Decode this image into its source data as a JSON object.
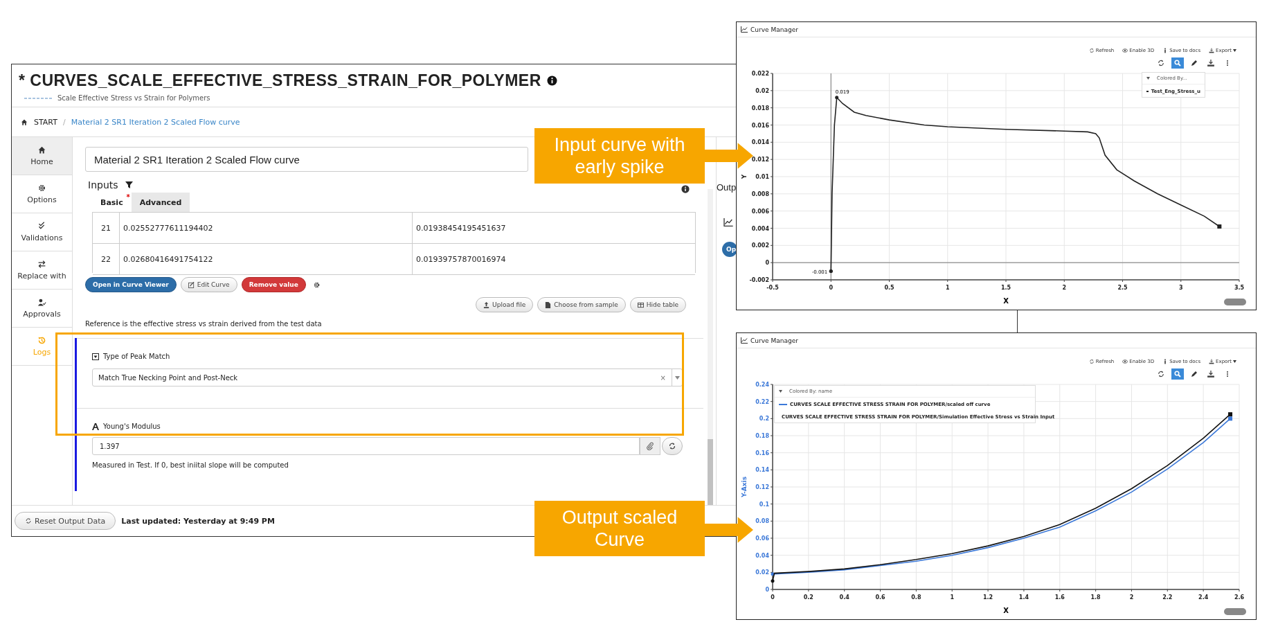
{
  "app_window": {
    "title_prefix": "*",
    "title": "CURVES_SCALE_EFFECTIVE_STRESS_STRAIN_FOR_POLYMER",
    "subtitle": "Scale Effective Stress vs Strain for Polymers",
    "breadcrumb_separator": "/",
    "breadcrumb": [
      {
        "label": "START"
      },
      {
        "label": "Material 2 SR1 Iteration 2 Scaled Flow curve"
      }
    ],
    "sidebar": {
      "items": [
        {
          "label": "Home",
          "selected": true,
          "highlighted": false
        },
        {
          "label": "Options",
          "selected": false,
          "highlighted": false
        },
        {
          "label": "Validations",
          "selected": false,
          "highlighted": false
        },
        {
          "label": "Replace with",
          "selected": false,
          "highlighted": false
        },
        {
          "label": "Approvals",
          "selected": false,
          "highlighted": false
        },
        {
          "label": "Logs",
          "selected": false,
          "highlighted": true
        }
      ]
    },
    "name_field": {
      "value": "Material 2 SR1 Iteration 2 Scaled Flow curve"
    },
    "inputs": {
      "heading": "Inputs",
      "tabs": [
        {
          "label": "Basic",
          "required_mark": "*",
          "selected": false
        },
        {
          "label": "Advanced",
          "selected": true
        }
      ],
      "table": {
        "rows": [
          [
            "21",
            "0.02552777611194402",
            "0.01938454195451637"
          ],
          [
            "22",
            "0.02680416491754122",
            "0.01939757870016974"
          ]
        ]
      },
      "buttons": [
        {
          "label": "Open in Curve Viewer",
          "kind": "primary"
        },
        {
          "label": "Edit Curve",
          "kind": "default"
        },
        {
          "label": "Remove value",
          "kind": "danger"
        }
      ],
      "file_buttons": [
        {
          "label": "Upload file"
        },
        {
          "label": "Choose from sample"
        },
        {
          "label": "Hide table"
        }
      ],
      "reference_text": "Reference is the effective stress vs strain derived from the test data",
      "fields": [
        {
          "kind": "select",
          "label": "Type of Peak Match",
          "value": "Match True Necking Point and Post-Neck",
          "clear_glyph": "×"
        },
        {
          "kind": "text",
          "label": "Young's Modulus",
          "value": "1.397",
          "hint": "Measured in Test. If 0, best iniital slope will be computed"
        }
      ]
    },
    "outputs": {
      "heading": "Outp",
      "button": "Op"
    },
    "footer": {
      "button": "Reset Output Data",
      "status": "Last updated: Yesterday at 9:49 PM"
    }
  },
  "callouts": [
    {
      "text": "Input curve with early spike"
    },
    {
      "text": "Output scaled Curve"
    }
  ],
  "chart_windows": [
    {
      "title": "Curve Manager",
      "toolbar": [
        "Refresh",
        "Enable 3D",
        "Save to docs",
        "Export"
      ],
      "legend_header": "Colored By...",
      "chart_data": {
        "type": "line",
        "grid": true,
        "xlabel": "X",
        "ylabel": "Y",
        "x": [
          0,
          0.01,
          0.03,
          0.05,
          0.1,
          0.2,
          0.3,
          0.5,
          0.8,
          1,
          1.5,
          2,
          2.2,
          2.27,
          2.3,
          2.35,
          2.45,
          2.6,
          2.8,
          3,
          3.2,
          3.33
        ],
        "series": [
          {
            "name": "Test_Eng_Stress_u",
            "color": "#222222",
            "values": [
              -0.001,
              0.008,
              0.016,
              0.0192,
              0.0185,
              0.0175,
              0.0171,
              0.0166,
              0.016,
              0.0158,
              0.0155,
              0.0153,
              0.0152,
              0.015,
              0.0145,
              0.0125,
              0.0108,
              0.0095,
              0.008,
              0.0067,
              0.0054,
              0.0042
            ]
          }
        ],
        "xlim": [
          -0.5,
          3.5
        ],
        "ylim": [
          -0.002,
          0.022
        ],
        "xticks": [
          -0.5,
          0,
          0.5,
          1,
          1.5,
          2,
          2.5,
          3,
          3.5
        ],
        "yticks": [
          -0.002,
          0,
          0.002,
          0.004,
          0.006,
          0.008,
          0.01,
          0.012,
          0.014,
          0.016,
          0.018,
          0.02,
          0.022
        ],
        "annotations": [
          {
            "x": 0.05,
            "y": 0.0192,
            "text": "0.019"
          },
          {
            "x": 0,
            "y": -0.001,
            "text": "-0.001"
          }
        ]
      }
    },
    {
      "title": "Curve Manager",
      "toolbar": [
        "Refresh",
        "Enable 3D",
        "Save to docs",
        "Export"
      ],
      "legend_header": "Colored By: name",
      "chart_data": {
        "type": "line",
        "grid": true,
        "xlabel": "X",
        "ylabel": "Y-Axis",
        "x": [
          0,
          0.01,
          0.2,
          0.4,
          0.6,
          0.8,
          1,
          1.2,
          1.4,
          1.6,
          1.8,
          2,
          2.2,
          2.4,
          2.55
        ],
        "series": [
          {
            "name": "CURVES SCALE EFFECTIVE STRESS STRAIN FOR POLYMER/scaled off curve",
            "color": "#3b78d8",
            "values": [
              0.018,
              0.018,
              0.02,
              0.023,
              0.028,
              0.033,
              0.04,
              0.049,
              0.06,
              0.073,
              0.092,
              0.114,
              0.141,
              0.172,
              0.2
            ]
          },
          {
            "name": "CURVES SCALE EFFECTIVE STRESS STRAIN FOR POLYMER/Simulation Effective Stress vs Strain Input",
            "color": "#111111",
            "values": [
              0.01,
              0.019,
              0.021,
              0.024,
              0.029,
              0.035,
              0.042,
              0.051,
              0.062,
              0.076,
              0.095,
              0.118,
              0.145,
              0.177,
              0.205
            ]
          }
        ],
        "xlim": [
          0,
          2.6
        ],
        "ylim": [
          0,
          0.24
        ],
        "xticks": [
          0,
          0.2,
          0.4,
          0.6,
          0.8,
          1,
          1.2,
          1.4,
          1.6,
          1.8,
          2,
          2.2,
          2.4,
          2.6
        ],
        "yticks": [
          0,
          0.02,
          0.04,
          0.06,
          0.08,
          0.1,
          0.12,
          0.14,
          0.16,
          0.18,
          0.2,
          0.22,
          0.24
        ]
      }
    }
  ]
}
